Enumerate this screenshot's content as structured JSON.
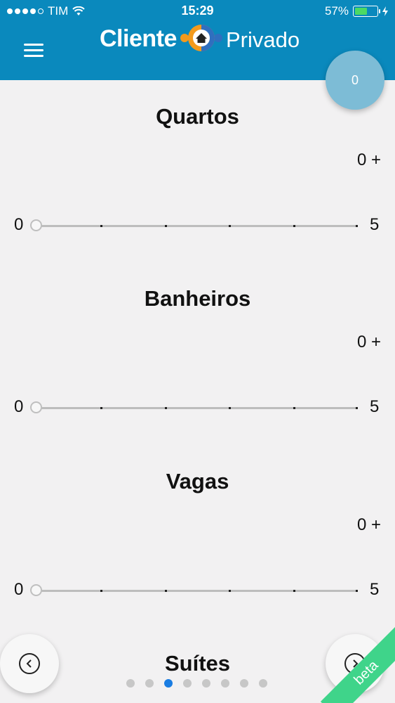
{
  "status_bar": {
    "carrier": "TIM",
    "time": "15:29",
    "battery": "57%"
  },
  "header": {
    "brand_part1": "Cliente",
    "brand_part2": "Privado"
  },
  "fab": {
    "count": "0"
  },
  "filters": [
    {
      "title": "Quartos",
      "value": "0 +",
      "min": "0",
      "max": "5",
      "level": 0
    },
    {
      "title": "Banheiros",
      "value": "0 +",
      "min": "0",
      "max": "5",
      "level": 0
    },
    {
      "title": "Vagas",
      "value": "0 +",
      "min": "0",
      "max": "5",
      "level": 0
    },
    {
      "title": "Suítes"
    }
  ],
  "pager": {
    "total": 8,
    "active_index": 2
  },
  "ribbon": "beta",
  "colors": {
    "header": "#0a89bd",
    "fab": "#7dbcd6",
    "active_dot": "#1a7de2",
    "ribbon": "#3fd48a"
  }
}
